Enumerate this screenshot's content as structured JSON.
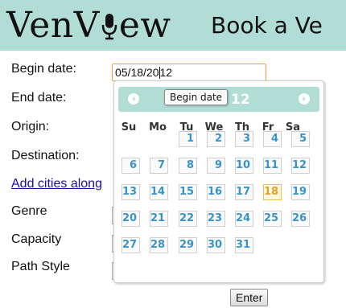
{
  "header": {
    "logo_prefix": "VenV",
    "logo_suffix": "ew",
    "subtitle": "Book a Ve"
  },
  "form": {
    "begin_date_label": "Begin date:",
    "end_date_label": "End date:",
    "origin_label": "Origin:",
    "destination_label": "Destination:",
    "add_cities_link": "Add cities along",
    "genre_label": "Genre",
    "capacity_label": "Capacity",
    "path_style_label": "Path Style",
    "begin_date_before_caret": "05/18/20",
    "begin_date_after_caret": "12",
    "enter_button": "Enter"
  },
  "datepicker": {
    "title_visible": "12",
    "tooltip": "Begin date",
    "weekdays": [
      "Su",
      "Mo",
      "Tu",
      "We",
      "Th",
      "Fr",
      "Sa"
    ],
    "selected_day": "18",
    "weeks": [
      [
        "",
        "",
        "1",
        "2",
        "3",
        "4",
        "5"
      ],
      [
        "6",
        "7",
        "8",
        "9",
        "10",
        "11",
        "12"
      ],
      [
        "13",
        "14",
        "15",
        "16",
        "17",
        "18",
        "19"
      ],
      [
        "20",
        "21",
        "22",
        "23",
        "24",
        "25",
        "26"
      ],
      [
        "27",
        "28",
        "29",
        "30",
        "31",
        "",
        ""
      ]
    ]
  },
  "colors": {
    "header_bg": "#b1ddd4",
    "day_text": "#3a93c8",
    "today_text": "#e0a030",
    "input_focus_border": "#e8a33a",
    "link": "#1a0dab"
  }
}
